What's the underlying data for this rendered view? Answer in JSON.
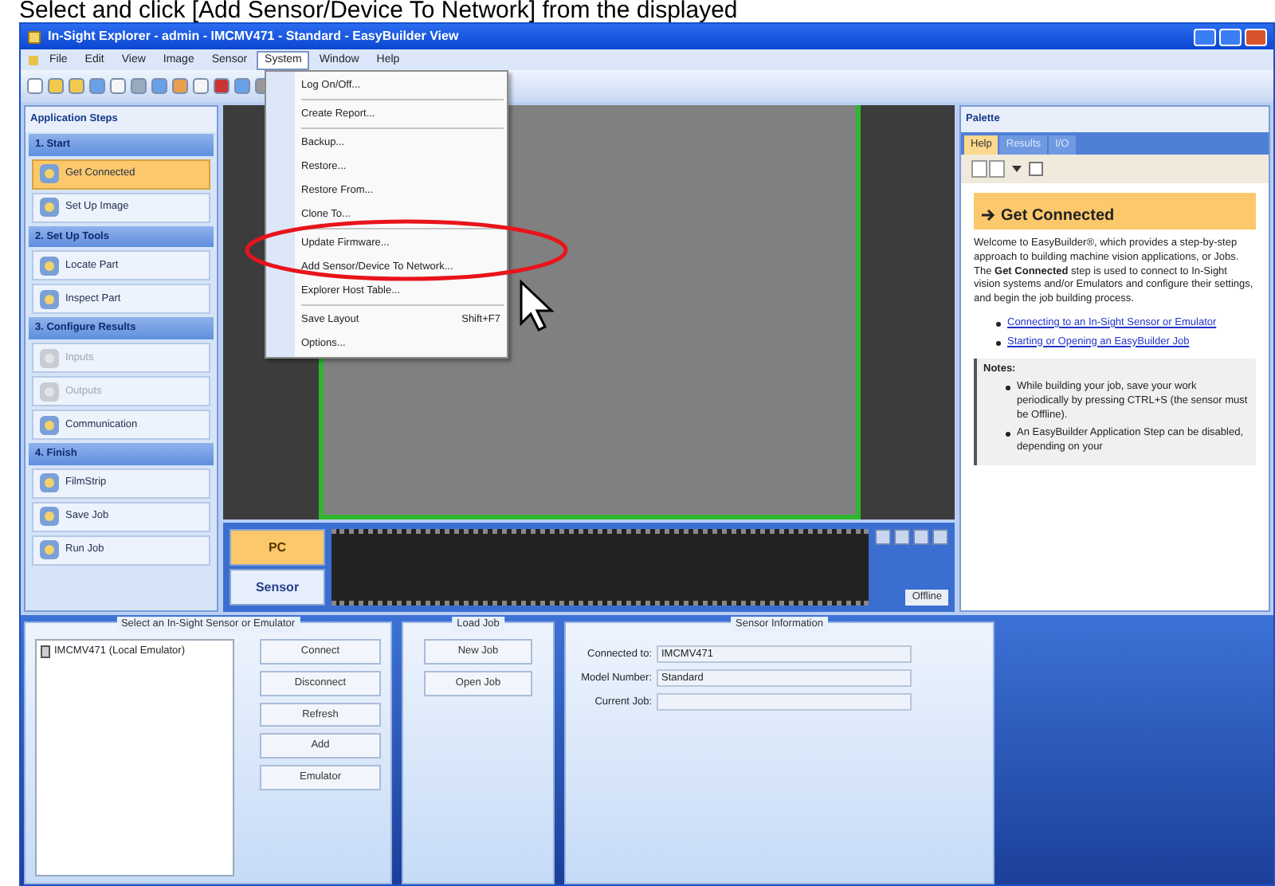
{
  "caption": "Select and click [Add Sensor/Device To Network] from the displayed",
  "window": {
    "title": "In-Sight Explorer - admin - IMCMV471 - Standard - EasyBuilder View"
  },
  "menu_bar": [
    {
      "label": "File",
      "selected": false
    },
    {
      "label": "Edit",
      "selected": false
    },
    {
      "label": "View",
      "selected": false
    },
    {
      "label": "Image",
      "selected": false
    },
    {
      "label": "Sensor",
      "selected": false
    },
    {
      "label": "System",
      "selected": true
    },
    {
      "label": "Window",
      "selected": false
    },
    {
      "label": "Help",
      "selected": false
    }
  ],
  "system_menu": [
    {
      "kind": "item",
      "label": "Log On/Off..."
    },
    {
      "kind": "separator"
    },
    {
      "kind": "item",
      "label": "Create Report..."
    },
    {
      "kind": "separator"
    },
    {
      "kind": "item",
      "label": "Backup..."
    },
    {
      "kind": "item",
      "label": "Restore..."
    },
    {
      "kind": "item",
      "label": "Restore From..."
    },
    {
      "kind": "item",
      "label": "Clone To..."
    },
    {
      "kind": "separator"
    },
    {
      "kind": "item",
      "label": "Update Firmware..."
    },
    {
      "kind": "item",
      "label": "Add Sensor/Device To Network..."
    },
    {
      "kind": "item",
      "label": "Explorer Host Table..."
    },
    {
      "kind": "separator"
    },
    {
      "kind": "item",
      "label": "Save Layout",
      "shortcut": "Shift+F7"
    },
    {
      "kind": "item",
      "label": "Options..."
    }
  ],
  "application_steps": {
    "title": "Application Steps",
    "sections": [
      {
        "title": "1. Start",
        "steps": [
          {
            "label": "Get Connected",
            "selected": true,
            "disabled": false
          },
          {
            "label": "Set Up Image",
            "selected": false,
            "disabled": false
          }
        ]
      },
      {
        "title": "2. Set Up Tools",
        "steps": [
          {
            "label": "Locate Part",
            "selected": false,
            "disabled": false
          },
          {
            "label": "Inspect Part",
            "selected": false,
            "disabled": false
          }
        ]
      },
      {
        "title": "3. Configure Results",
        "steps": [
          {
            "label": "Inputs",
            "selected": false,
            "disabled": true
          },
          {
            "label": "Outputs",
            "selected": false,
            "disabled": true
          },
          {
            "label": "Communication",
            "selected": false,
            "disabled": false
          }
        ]
      },
      {
        "title": "4. Finish",
        "steps": [
          {
            "label": "FilmStrip",
            "selected": false,
            "disabled": false
          },
          {
            "label": "Save Job",
            "selected": false,
            "disabled": false
          },
          {
            "label": "Run Job",
            "selected": false,
            "disabled": false
          }
        ]
      }
    ]
  },
  "view": {
    "source_buttons": [
      {
        "label": "PC",
        "selected": true
      },
      {
        "label": "Sensor",
        "selected": false
      }
    ],
    "status": "Offline"
  },
  "palette": {
    "title": "Palette",
    "tabs": [
      {
        "label": "Help",
        "selected": true
      },
      {
        "label": "Results",
        "selected": false
      },
      {
        "label": "I/O",
        "selected": false
      }
    ],
    "heading": "Get Connected",
    "intro": "Welcome to EasyBuilder®, which provides a step-by-step approach to building machine vision applications, or Jobs. The **Get Connected** step is used to connect to In-Sight vision systems and/or Emulators and configure their settings, and begin the job building process.",
    "links": [
      "Connecting to an In-Sight Sensor or Emulator",
      "Starting or Opening an EasyBuilder Job"
    ],
    "notes_title": "Notes:",
    "notes": [
      "While building your job, save your work periodically by pressing CTRL+S (the sensor must be Offline).",
      "An EasyBuilder Application Step can be disabled, depending on your"
    ]
  },
  "connect_panel": {
    "title": "Select an In-Sight Sensor or Emulator",
    "sensors": [
      {
        "label": "IMCMV471 (Local Emulator)",
        "selected": false
      }
    ],
    "buttons": [
      "Connect",
      "Disconnect",
      "Refresh",
      "Add",
      "Emulator"
    ]
  },
  "load_job_panel": {
    "title": "Load Job",
    "buttons": [
      "New Job",
      "Open Job"
    ]
  },
  "sensor_info_panel": {
    "title": "Sensor Information",
    "fields": [
      {
        "label": "Connected to:",
        "value": "IMCMV471"
      },
      {
        "label": "Model Number:",
        "value": "Standard"
      },
      {
        "label": "Current Job:"
      }
    ]
  }
}
